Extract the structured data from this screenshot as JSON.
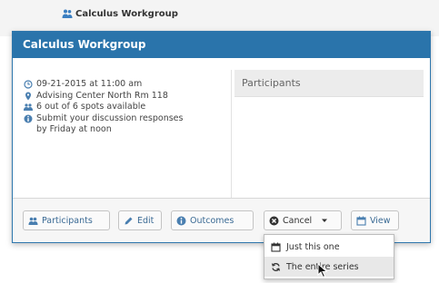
{
  "background": {
    "event_title": "Calculus Workgroup"
  },
  "modal": {
    "title": "Calculus Workgroup",
    "details": {
      "datetime": "09-21-2015 at 11:00 am",
      "location": "Advising Center North Rm 118",
      "availability": "6 out of 6 spots available",
      "note_line1": "Submit your discussion responses",
      "note_line2": "by Friday at noon"
    },
    "participants_heading": "Participants",
    "footer_buttons": {
      "participants": "Participants",
      "edit": "Edit",
      "outcomes": "Outcomes",
      "cancel": "Cancel",
      "view": "View"
    }
  },
  "cancel_menu": {
    "items": [
      {
        "label": "Just this one",
        "icon": "calendar-icon"
      },
      {
        "label": "The entire series",
        "icon": "refresh-icon"
      }
    ]
  },
  "colors": {
    "header_blue": "#2a74ab",
    "link_blue": "#3a6a94"
  }
}
